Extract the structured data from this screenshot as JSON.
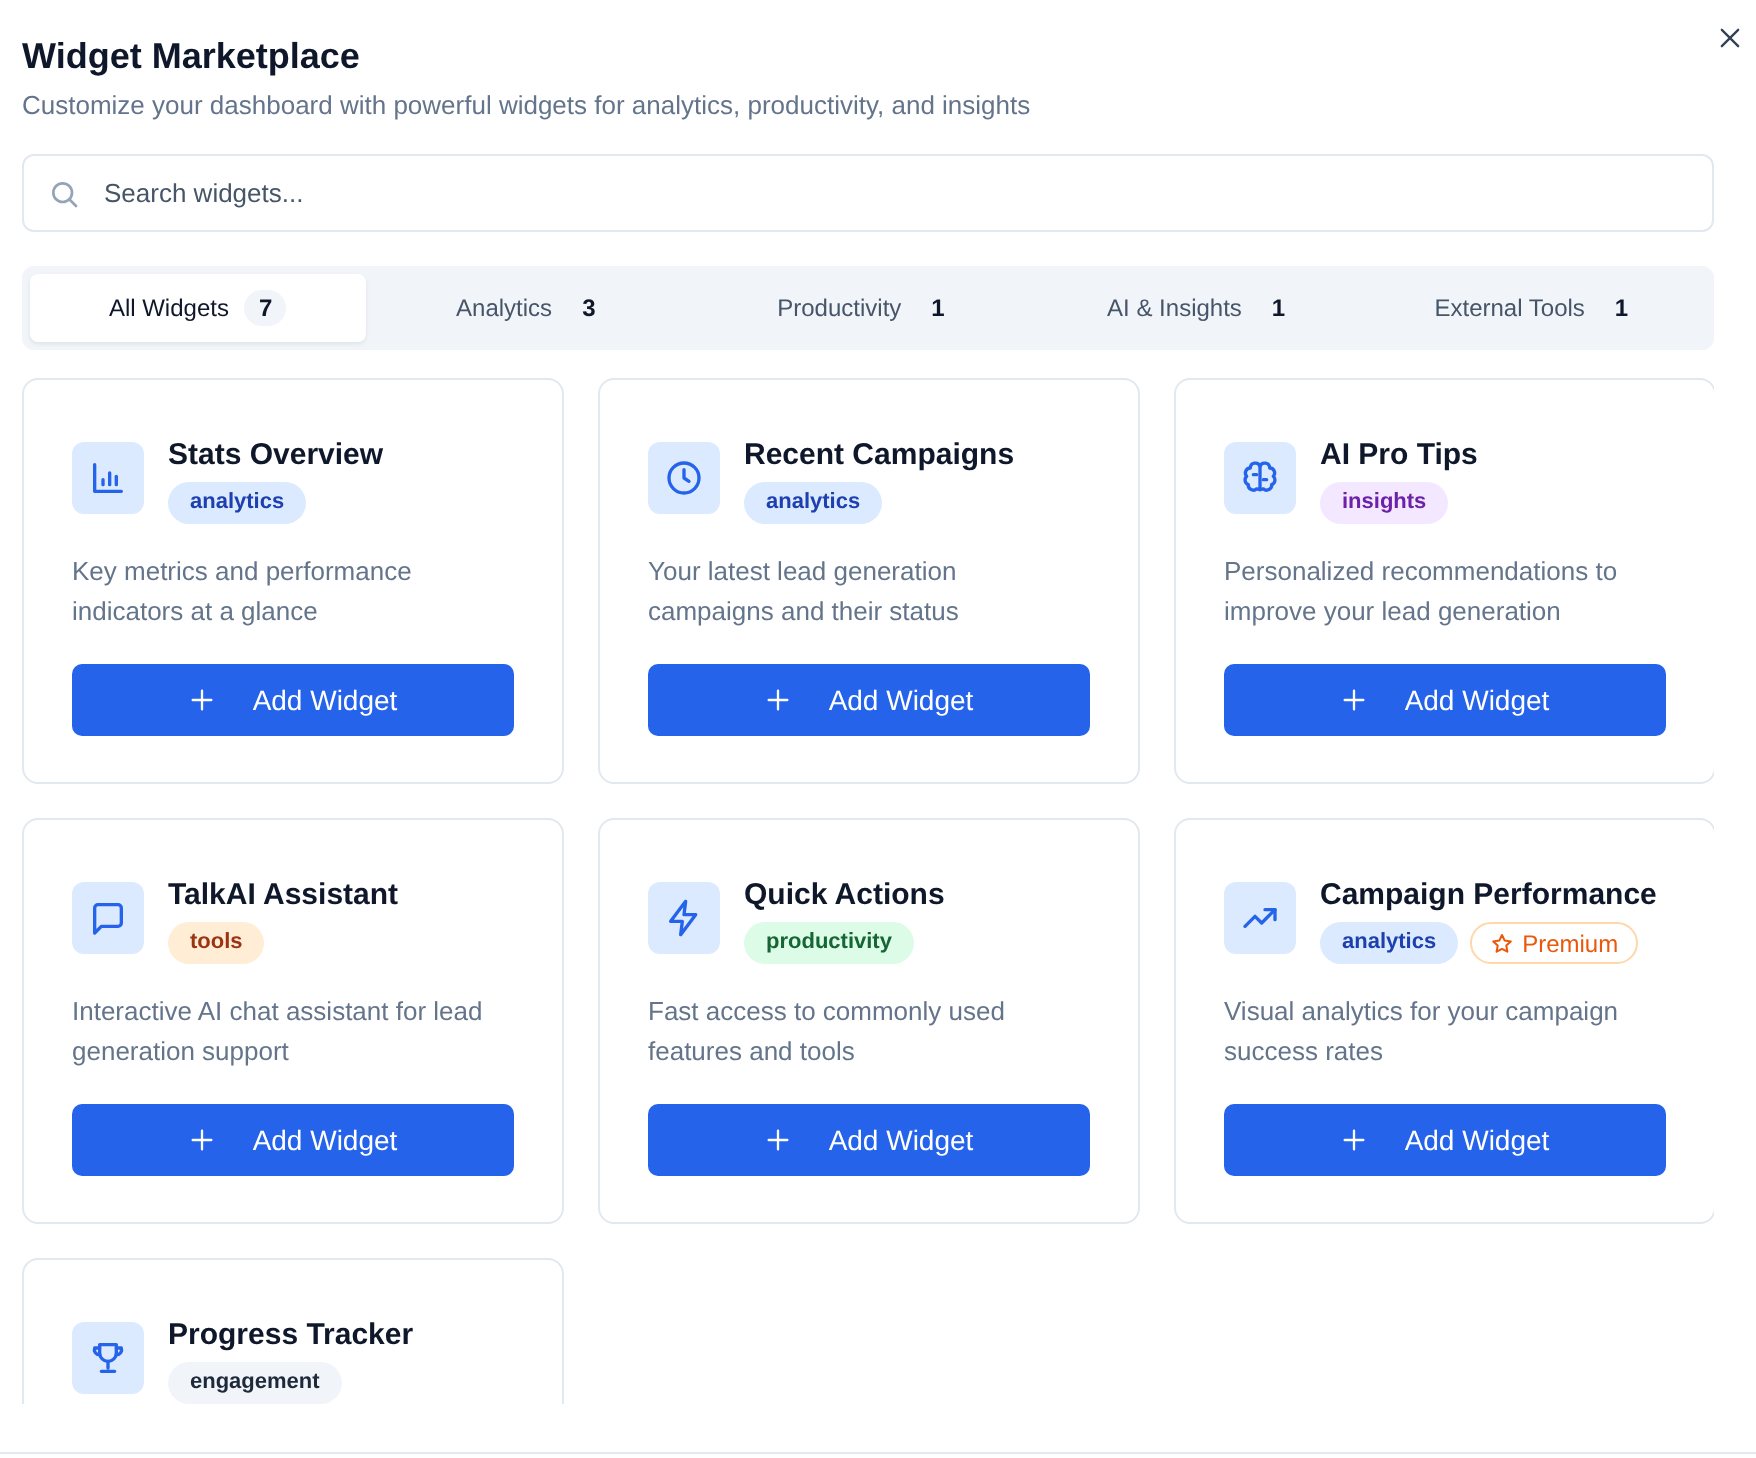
{
  "dialog": {
    "title": "Widget Marketplace",
    "subtitle": "Customize your dashboard with powerful widgets for analytics, productivity, and insights"
  },
  "search": {
    "placeholder": "Search widgets..."
  },
  "tabs": [
    {
      "label": "All Widgets",
      "count": "7",
      "selected": true
    },
    {
      "label": "Analytics",
      "count": "3",
      "selected": false
    },
    {
      "label": "Productivity",
      "count": "1",
      "selected": false
    },
    {
      "label": "AI & Insights",
      "count": "1",
      "selected": false
    },
    {
      "label": "External Tools",
      "count": "1",
      "selected": false
    }
  ],
  "widgets": [
    {
      "kind": "bar-chart",
      "title": "Stats Overview",
      "tag": {
        "label": "analytics",
        "color": "#dbeafe"
      },
      "description": "Key metrics and performance indicators at a glance",
      "button": "Add Widget"
    },
    {
      "kind": "clock",
      "title": "Recent Campaigns",
      "tag": {
        "label": "analytics",
        "color": "#dbeafe"
      },
      "description": "Your latest lead generation campaigns and their status",
      "button": "Add Widget"
    },
    {
      "kind": "brain",
      "title": "AI Pro Tips",
      "tag": {
        "label": "insights",
        "color": "#f3e8ff"
      },
      "description": "Personalized recommendations to improve your lead generation",
      "button": "Add Widget"
    },
    {
      "kind": "chat",
      "title": "TalkAI Assistant",
      "tag": {
        "label": "tools",
        "color": "#ffedd5"
      },
      "description": "Interactive AI chat assistant for lead generation support",
      "button": "Add Widget"
    },
    {
      "kind": "bolt",
      "title": "Quick Actions",
      "tag": {
        "label": "productivity",
        "color": "#dcfce7"
      },
      "description": "Fast access to commonly used features and tools",
      "button": "Add Widget"
    },
    {
      "kind": "trend",
      "title": "Campaign Performance",
      "tag": {
        "label": "analytics",
        "color": "#dbeafe"
      },
      "premium": "Premium",
      "description": "Visual analytics for your campaign success rates",
      "button": "Add Widget"
    },
    {
      "kind": "trophy",
      "title": "Progress Tracker",
      "tag": {
        "label": "engagement",
        "color": "#f1f5f9"
      }
    }
  ]
}
